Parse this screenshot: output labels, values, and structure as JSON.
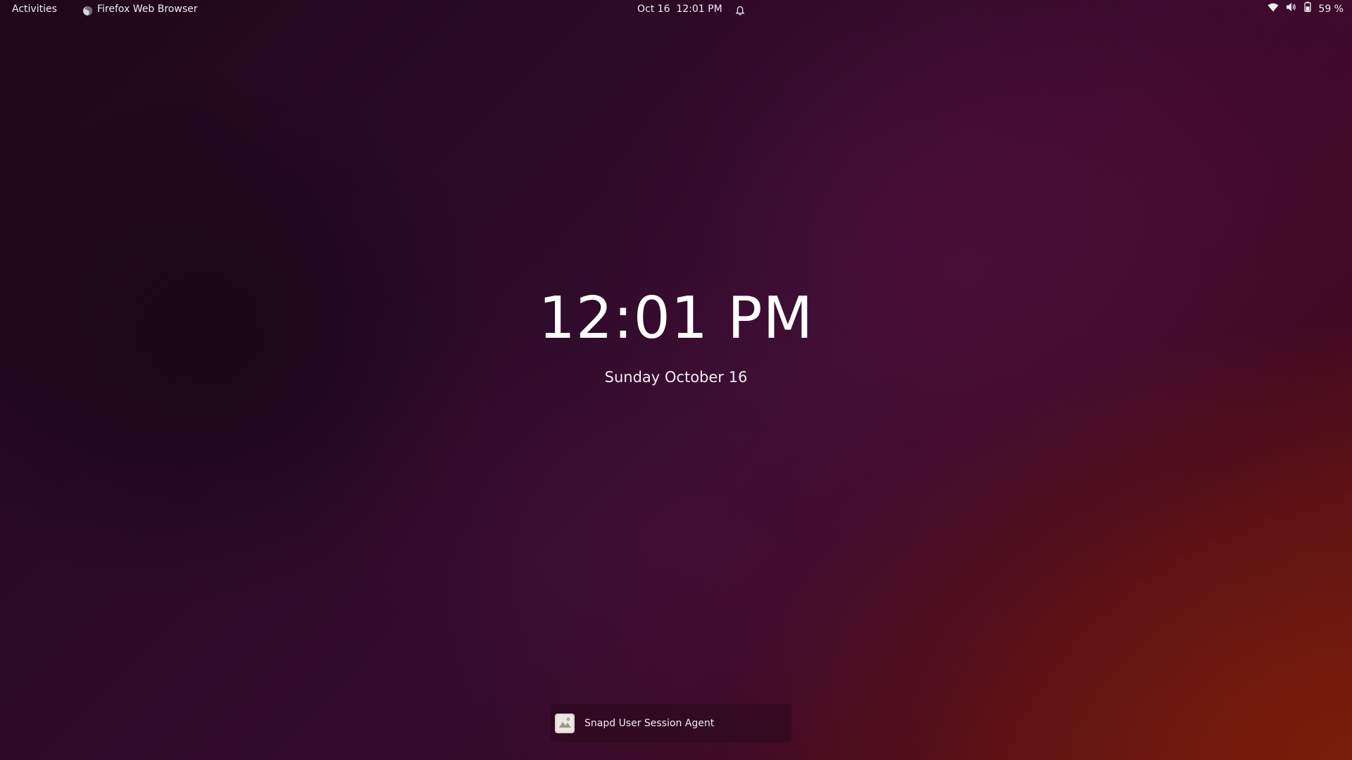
{
  "top_bar": {
    "activities_label": "Activities",
    "app_menu": {
      "label": "Firefox Web Browser",
      "icon": "firefox-icon"
    },
    "clock": {
      "datetime": "Oct 16  12:01 PM",
      "icon": "bell-icon"
    },
    "status": {
      "wifi_icon": "wifi-icon",
      "volume_icon": "volume-icon",
      "battery_icon": "battery-icon",
      "battery_label": "59 %",
      "battery_level": 0.59
    }
  },
  "lock_screen": {
    "time": "12:01 PM",
    "date": "Sunday October 16"
  },
  "notifications": [
    {
      "title": "Snapd User Session Agent",
      "icon": "snapd-icon"
    }
  ],
  "colors": {
    "text": "#ffffff",
    "wallpaper_dark": "#1f0819",
    "wallpaper_accent": "#5a1212"
  }
}
